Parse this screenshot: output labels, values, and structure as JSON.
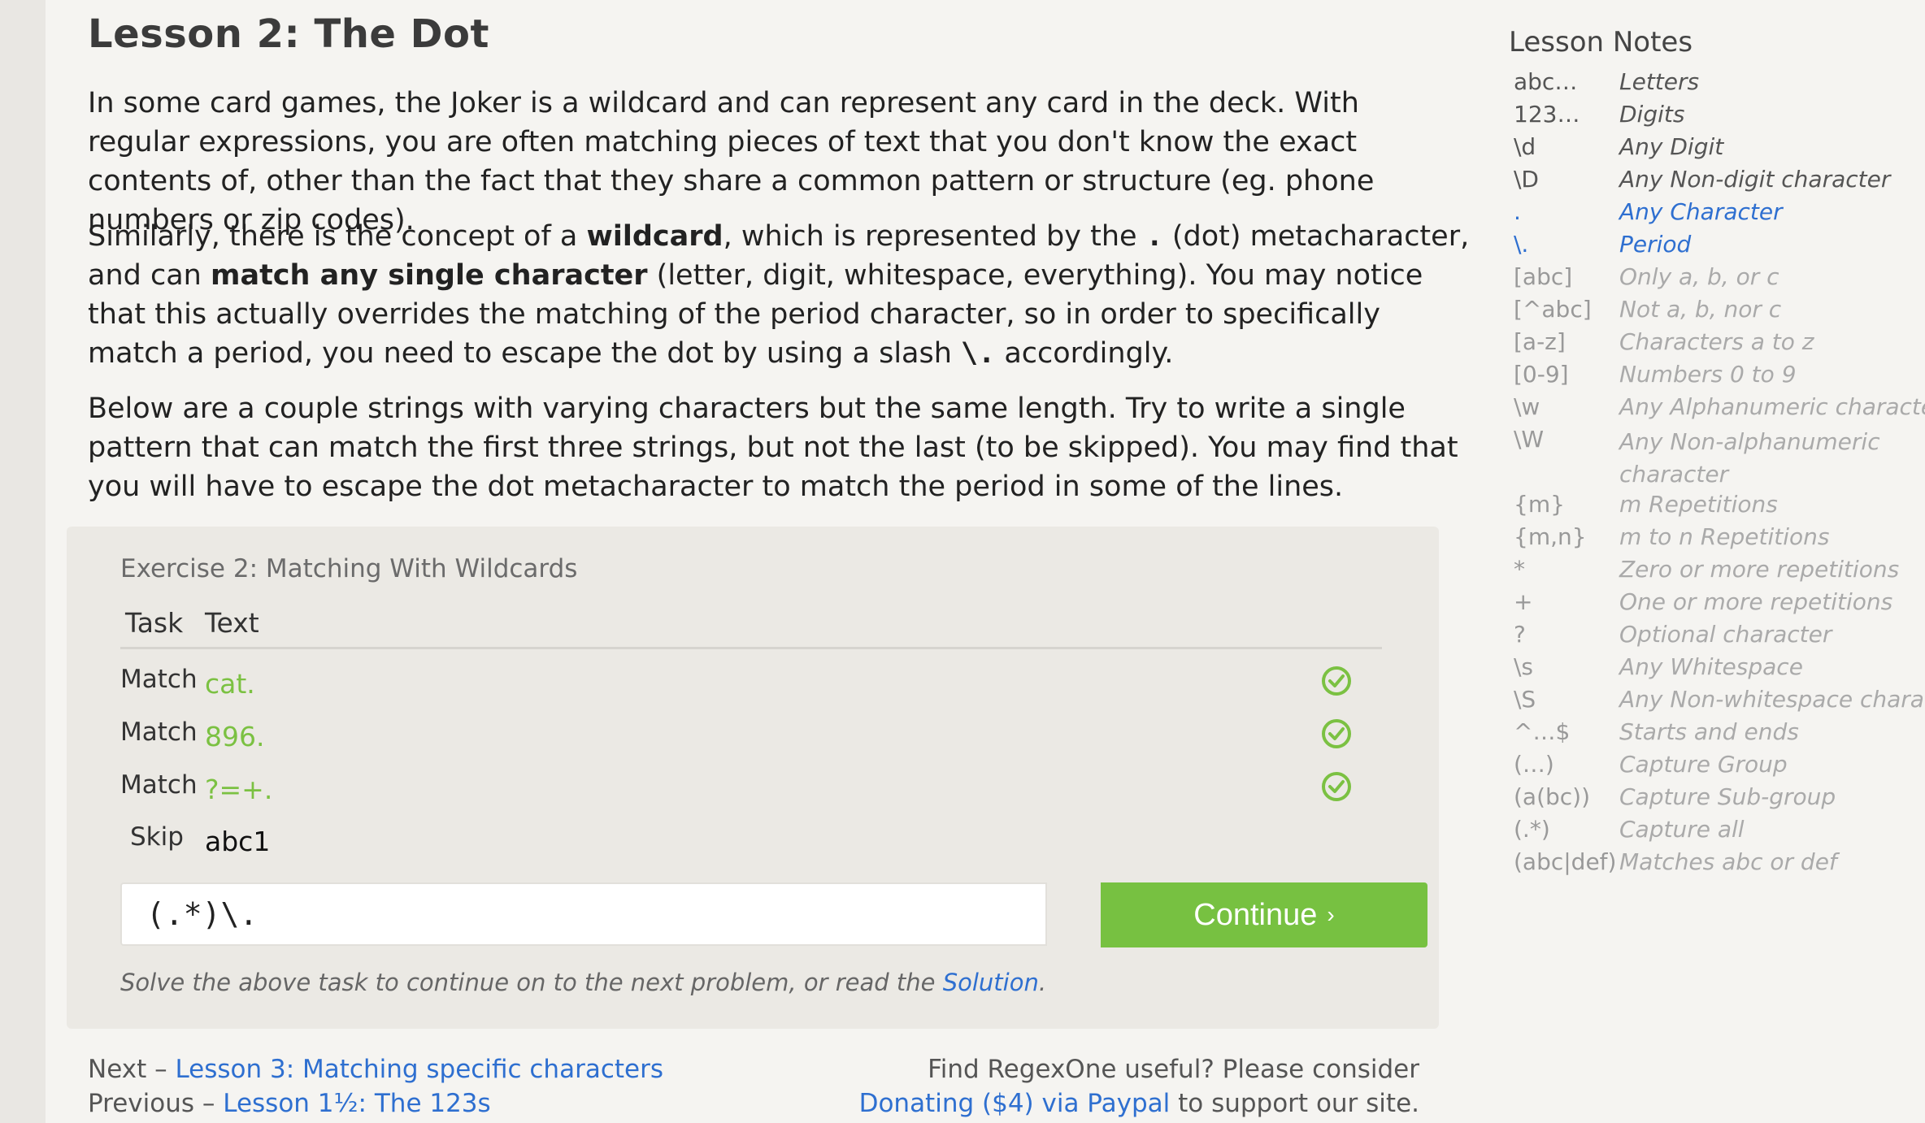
{
  "lesson": {
    "title": "Lesson 2: The Dot",
    "p1": "In some card games, the Joker is a wildcard and can represent any card in the deck. With regular expressions, you are often matching pieces of text that you don't know the exact contents of, other than the fact that they share a common pattern or structure (eg. phone numbers or zip codes).",
    "p2_a": "Similarly, there is the concept of a ",
    "p2_b": "wildcard",
    "p2_c": ", which is represented by the ",
    "p2_d": ".",
    "p2_e": " (dot) metacharacter, and can ",
    "p2_f": "match any single character",
    "p2_g": " (letter, digit, whitespace, everything). You may notice that this actually overrides the matching of the period character, so in order to specifically match a period, you need to escape the dot by using a slash ",
    "p2_h": "\\.",
    "p2_i": " accordingly.",
    "p3": "Below are a couple strings with varying characters but the same length. Try to write a single pattern that can match the first three strings, but not the last (to be skipped). You may find that you will have to escape the dot metacharacter to match the period in some of the lines."
  },
  "exercise": {
    "title": "Exercise 2: Matching With Wildcards",
    "col_task": "Task",
    "col_text": "Text",
    "rows": [
      {
        "task": "Match",
        "text": "cat.",
        "status": "matched"
      },
      {
        "task": "Match",
        "text": "896.",
        "status": "matched"
      },
      {
        "task": "Match",
        "text": "?=+.",
        "status": "matched"
      },
      {
        "task": "Skip",
        "text": "abc1",
        "status": "skip"
      }
    ],
    "input_value": "(.*)\\.",
    "continue_label": "Continue",
    "continue_chevron": "›",
    "hint_prefix": "Solve the above task to continue on to the next problem, or read the ",
    "hint_link": "Solution",
    "hint_suffix": ".",
    "check_color": "#7bc142"
  },
  "footer": {
    "next_prefix": "Next – ",
    "next_link": "Lesson 3: Matching specific characters",
    "prev_prefix": "Previous – ",
    "prev_link": "Lesson 1½: The 123s",
    "support_1": "Find RegexOne useful? Please consider",
    "support_link": "Donating ($4) via Paypal",
    "support_suffix": " to support our site."
  },
  "notes": {
    "title": "Lesson Notes",
    "items": [
      {
        "sym": "abc…",
        "desc": "Letters",
        "state": "seen"
      },
      {
        "sym": "123…",
        "desc": "Digits",
        "state": "seen"
      },
      {
        "sym": "\\d",
        "desc": "Any Digit",
        "state": "seen"
      },
      {
        "sym": "\\D",
        "desc": "Any Non-digit character",
        "state": "seen"
      },
      {
        "sym": ".",
        "desc": "Any Character",
        "state": "current"
      },
      {
        "sym": "\\.",
        "desc": "Period",
        "state": "current"
      },
      {
        "sym": "[abc]",
        "desc": "Only a, b, or c",
        "state": "future"
      },
      {
        "sym": "[^abc]",
        "desc": "Not a, b, nor c",
        "state": "future"
      },
      {
        "sym": "[a-z]",
        "desc": "Characters a to z",
        "state": "future"
      },
      {
        "sym": "[0-9]",
        "desc": "Numbers 0 to 9",
        "state": "future"
      },
      {
        "sym": "\\w",
        "desc": "Any Alphanumeric character",
        "state": "future"
      },
      {
        "sym": "\\W",
        "desc": "Any Non-alphanumeric character",
        "state": "future"
      },
      {
        "sym": "{m}",
        "desc": "m Repetitions",
        "state": "future"
      },
      {
        "sym": "{m,n}",
        "desc": "m to n Repetitions",
        "state": "future"
      },
      {
        "sym": "*",
        "desc": "Zero or more repetitions",
        "state": "future"
      },
      {
        "sym": "+",
        "desc": "One or more repetitions",
        "state": "future"
      },
      {
        "sym": "?",
        "desc": "Optional character",
        "state": "future"
      },
      {
        "sym": "\\s",
        "desc": "Any Whitespace",
        "state": "future"
      },
      {
        "sym": "\\S",
        "desc": "Any Non-whitespace character",
        "state": "future"
      },
      {
        "sym": "^…$",
        "desc": "Starts and ends",
        "state": "future"
      },
      {
        "sym": "(…)",
        "desc": "Capture Group",
        "state": "future"
      },
      {
        "sym": "(a(bc))",
        "desc": "Capture Sub-group",
        "state": "future"
      },
      {
        "sym": "(.*)",
        "desc": "Capture all",
        "state": "future"
      },
      {
        "sym": "(abc|def)",
        "desc": "Matches abc or def",
        "state": "future"
      }
    ]
  }
}
